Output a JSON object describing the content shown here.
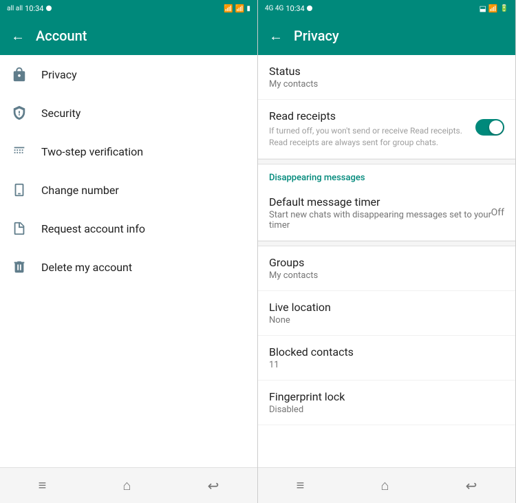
{
  "left_panel": {
    "status_bar": {
      "time": "10:34",
      "signal": "all all",
      "dot_color": "white"
    },
    "header": {
      "title": "Account",
      "back_label": "←"
    },
    "menu_items": [
      {
        "id": "privacy",
        "label": "Privacy",
        "icon": "lock"
      },
      {
        "id": "security",
        "label": "Security",
        "icon": "shield"
      },
      {
        "id": "two-step",
        "label": "Two-step verification",
        "icon": "dots"
      },
      {
        "id": "change-number",
        "label": "Change number",
        "icon": "phone"
      },
      {
        "id": "request-info",
        "label": "Request account info",
        "icon": "doc"
      },
      {
        "id": "delete-account",
        "label": "Delete my account",
        "icon": "trash"
      }
    ],
    "bottom_nav": [
      "≡",
      "⌂",
      "↩"
    ]
  },
  "right_panel": {
    "status_bar": {
      "time": "10:34"
    },
    "header": {
      "title": "Privacy",
      "back_label": "←"
    },
    "privacy_items": [
      {
        "id": "status",
        "label": "Status",
        "subtitle": "My contacts",
        "value": ""
      },
      {
        "id": "read-receipts",
        "label": "Read receipts",
        "subtitle": "",
        "desc": "If turned off, you won't send or receive Read receipts. Read receipts are always sent for group chats.",
        "toggle": true
      },
      {
        "id": "disappearing-section",
        "section_label": "Disappearing messages"
      },
      {
        "id": "default-timer",
        "label": "Default message timer",
        "subtitle": "Start new chats with disappearing messages set to your timer",
        "value": "Off"
      },
      {
        "id": "groups",
        "label": "Groups",
        "subtitle": "My contacts",
        "value": ""
      },
      {
        "id": "live-location",
        "label": "Live location",
        "subtitle": "None",
        "value": ""
      },
      {
        "id": "blocked-contacts",
        "label": "Blocked contacts",
        "subtitle": "11",
        "value": ""
      },
      {
        "id": "fingerprint-lock",
        "label": "Fingerprint lock",
        "subtitle": "Disabled",
        "value": ""
      }
    ],
    "bottom_nav": [
      "≡",
      "⌂",
      "↩"
    ]
  }
}
